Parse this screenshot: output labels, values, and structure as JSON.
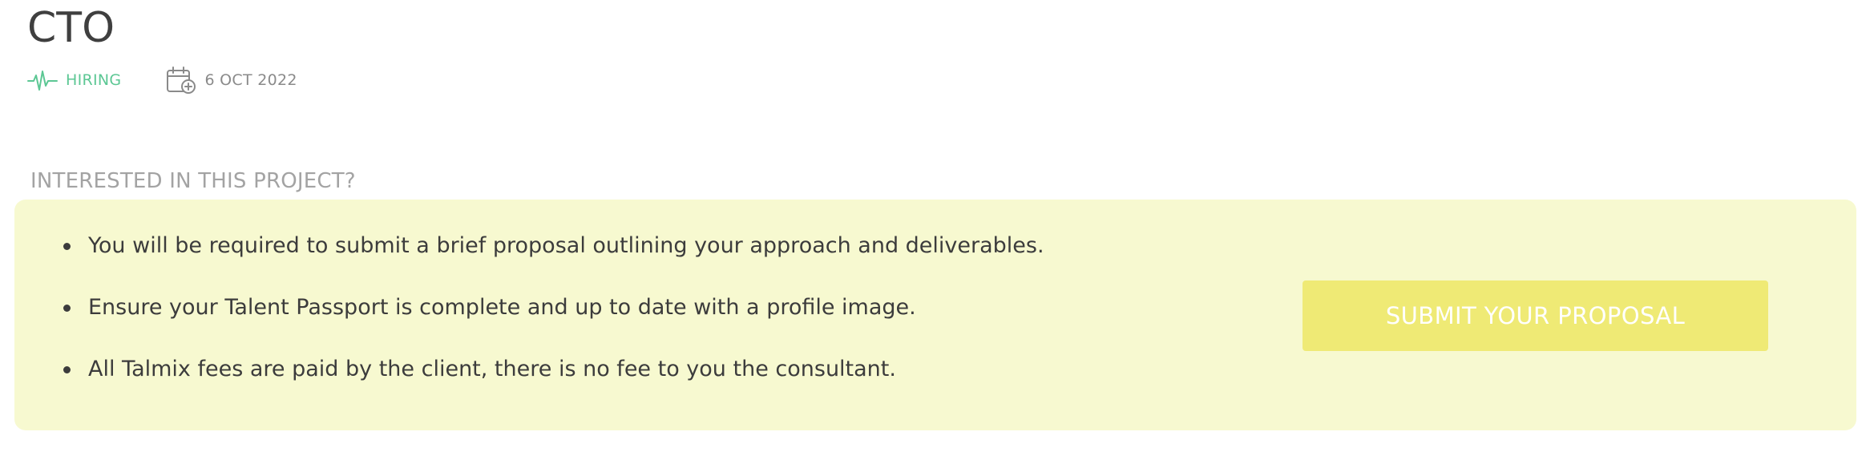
{
  "project": {
    "title": "CTO",
    "status": "HIRING",
    "date": "6 OCT 2022"
  },
  "icons": {
    "status": "activity-pulse-icon",
    "date": "calendar-add-icon"
  },
  "interest": {
    "heading": "INTERESTED IN THIS PROJECT?",
    "bullets": [
      "You will be required to submit a brief proposal outlining your approach and deliverables.",
      "Ensure your Talent Passport is complete and up to date with a profile image.",
      "All Talmix fees are paid by the client, there is no fee to you the consultant."
    ],
    "button_label": "SUBMIT YOUR PROPOSAL"
  },
  "colors": {
    "status_green": "#5cc794",
    "panel_background": "#f7f9d0",
    "button_background": "#efea75",
    "button_text": "#ffffff"
  }
}
